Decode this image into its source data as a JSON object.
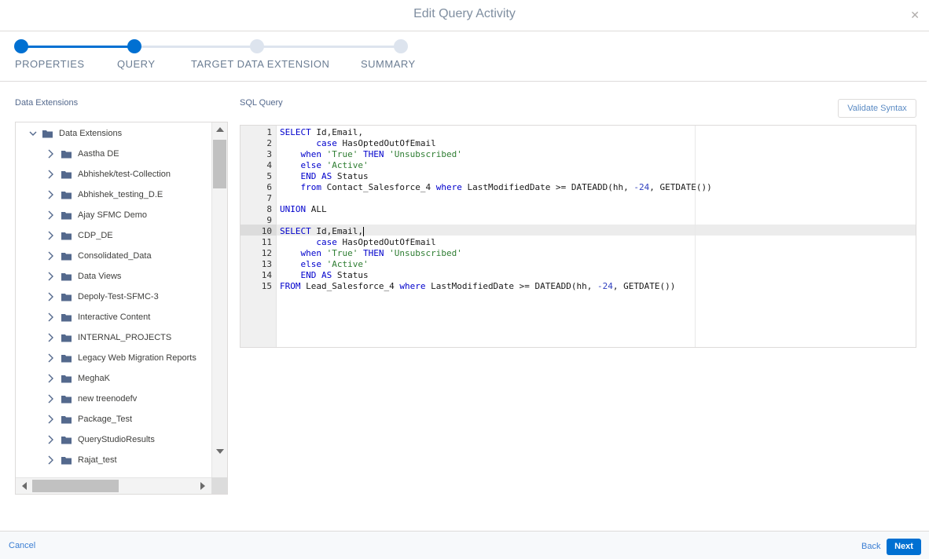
{
  "modal": {
    "title": "Edit Query Activity",
    "close_icon": "close-icon"
  },
  "stepper": {
    "colors": {
      "done": "#0070d2",
      "pending": "#dde4ee"
    },
    "steps": [
      {
        "label": "PROPERTIES",
        "state": "complete"
      },
      {
        "label": "QUERY",
        "state": "current"
      },
      {
        "label": "TARGET DATA EXTENSION",
        "state": "pending"
      },
      {
        "label": "SUMMARY",
        "state": "pending"
      }
    ]
  },
  "left_panel": {
    "label": "Data Extensions",
    "tree": {
      "root": {
        "label": "Data Extensions",
        "expanded": true,
        "icon": "folder-icon"
      },
      "items": [
        {
          "label": "Aastha DE"
        },
        {
          "label": "Abhishek/test-Collection"
        },
        {
          "label": "Abhishek_testing_D.E"
        },
        {
          "label": "Ajay SFMC Demo"
        },
        {
          "label": "CDP_DE"
        },
        {
          "label": "Consolidated_Data"
        },
        {
          "label": "Data Views"
        },
        {
          "label": "Depoly-Test-SFMC-3"
        },
        {
          "label": "Interactive Content"
        },
        {
          "label": "INTERNAL_PROJECTS"
        },
        {
          "label": "Legacy Web Migration Reports"
        },
        {
          "label": "MeghaK"
        },
        {
          "label": "new treenodefv"
        },
        {
          "label": "Package_Test"
        },
        {
          "label": "QueryStudioResults"
        },
        {
          "label": "Rajat_test"
        }
      ]
    }
  },
  "sql_panel": {
    "label": "SQL Query",
    "validate_label": "Validate Syntax",
    "active_line": 10,
    "line_numbers": [
      "1",
      "2",
      "3",
      "4",
      "5",
      "6",
      "7",
      "8",
      "9",
      "10",
      "11",
      "12",
      "13",
      "14",
      "15"
    ],
    "lines": [
      [
        [
          "kw",
          "SELECT"
        ],
        [
          "t",
          " Id,Email,"
        ]
      ],
      [
        [
          "t",
          "       "
        ],
        [
          "kw",
          "case"
        ],
        [
          "t",
          " HasOptedOutOfEmail"
        ]
      ],
      [
        [
          "t",
          "    "
        ],
        [
          "kw",
          "when"
        ],
        [
          "t",
          " "
        ],
        [
          "str",
          "'True'"
        ],
        [
          "t",
          " "
        ],
        [
          "kw",
          "THEN"
        ],
        [
          "t",
          " "
        ],
        [
          "str",
          "'Unsubscribed'"
        ]
      ],
      [
        [
          "t",
          "    "
        ],
        [
          "kw",
          "else"
        ],
        [
          "t",
          " "
        ],
        [
          "str",
          "'Active'"
        ]
      ],
      [
        [
          "t",
          "    "
        ],
        [
          "kw",
          "END"
        ],
        [
          "t",
          " "
        ],
        [
          "kw",
          "AS"
        ],
        [
          "t",
          " Status"
        ]
      ],
      [
        [
          "t",
          "    "
        ],
        [
          "kw",
          "from"
        ],
        [
          "t",
          " Contact_Salesforce_4 "
        ],
        [
          "kw",
          "where"
        ],
        [
          "t",
          " LastModifiedDate >= DATEADD(hh, "
        ],
        [
          "num",
          "-24"
        ],
        [
          "t",
          ", GETDATE())"
        ]
      ],
      [],
      [
        [
          "kw",
          "UNION"
        ],
        [
          "t",
          " ALL"
        ]
      ],
      [],
      [
        [
          "kw",
          "SELECT"
        ],
        [
          "t",
          " Id,Email,"
        ]
      ],
      [
        [
          "t",
          "       "
        ],
        [
          "kw",
          "case"
        ],
        [
          "t",
          " HasOptedOutOfEmail"
        ]
      ],
      [
        [
          "t",
          "    "
        ],
        [
          "kw",
          "when"
        ],
        [
          "t",
          " "
        ],
        [
          "str",
          "'True'"
        ],
        [
          "t",
          " "
        ],
        [
          "kw",
          "THEN"
        ],
        [
          "t",
          " "
        ],
        [
          "str",
          "'Unsubscribed'"
        ]
      ],
      [
        [
          "t",
          "    "
        ],
        [
          "kw",
          "else"
        ],
        [
          "t",
          " "
        ],
        [
          "str",
          "'Active'"
        ]
      ],
      [
        [
          "t",
          "    "
        ],
        [
          "kw",
          "END"
        ],
        [
          "t",
          " "
        ],
        [
          "kw",
          "AS"
        ],
        [
          "t",
          " Status"
        ]
      ],
      [
        [
          "kw",
          "FROM"
        ],
        [
          "t",
          " Lead_Salesforce_4 "
        ],
        [
          "kw",
          "where"
        ],
        [
          "t",
          " LastModifiedDate >= DATEADD(hh, "
        ],
        [
          "num",
          "-24"
        ],
        [
          "t",
          ", GETDATE())"
        ]
      ]
    ]
  },
  "footer": {
    "cancel_label": "Cancel",
    "back_label": "Back",
    "next_label": "Next"
  }
}
